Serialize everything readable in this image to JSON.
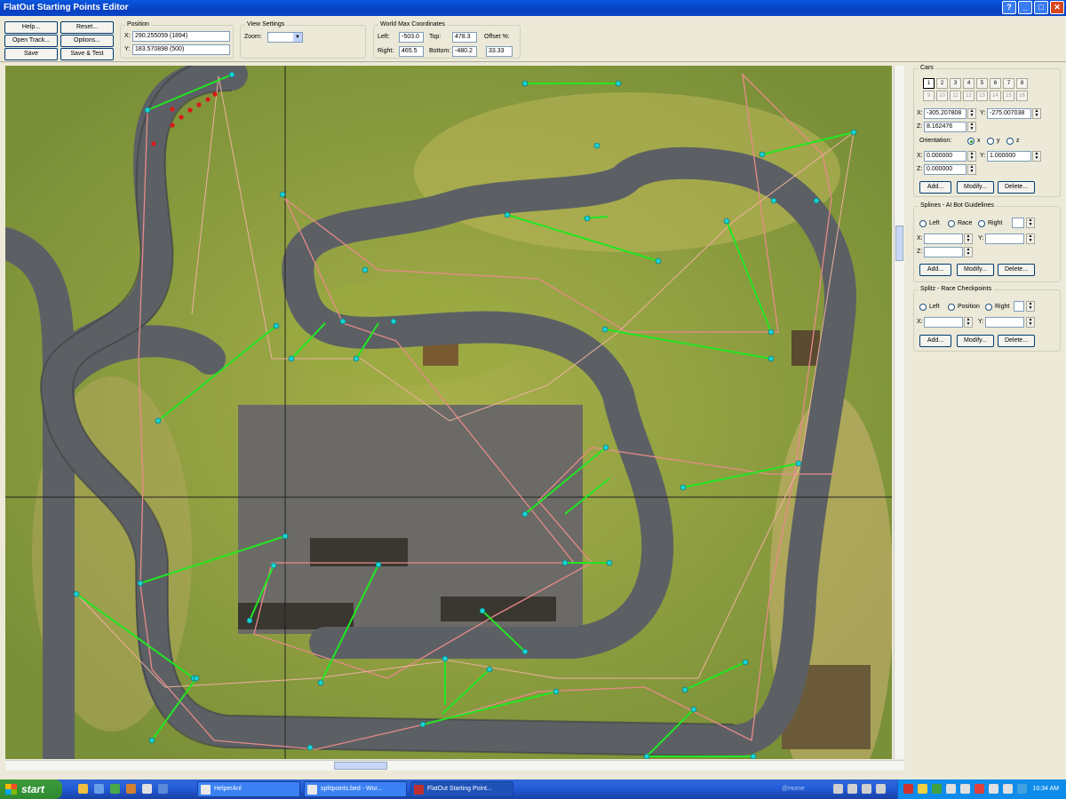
{
  "window": {
    "title": "FlatOut Starting Points Editor",
    "buttons": [
      "_",
      "□",
      "▭",
      "✕"
    ]
  },
  "toolbar": {
    "help": "Help...",
    "reset": "Reset...",
    "open_track": "Open Track...",
    "options": "Options...",
    "save": "Save",
    "save_test": "Save & Test"
  },
  "position": {
    "label": "Position",
    "x_label": "X:",
    "x_value": "290.255059  (1894)",
    "y_label": "Y:",
    "y_value": "183.570898  (500)"
  },
  "view": {
    "label": "View Settings",
    "zoom_label": "Zoom:",
    "zoom_value": ""
  },
  "world": {
    "label": "World Max Coordinates",
    "left_label": "Left:",
    "left": "-503.0",
    "top_label": "Top:",
    "top": "478.3",
    "right_label": "Right:",
    "right": "465.5",
    "bottom_label": "Bottom:",
    "bottom": "-480.2",
    "offset_label": "Offset %:",
    "offset": "33.33"
  },
  "cars": {
    "label": "Cars",
    "row1": [
      "1",
      "2",
      "3",
      "4",
      "5",
      "6",
      "7",
      "8"
    ],
    "row2": [
      "9",
      "10",
      "11",
      "12",
      "13",
      "14",
      "15",
      "16"
    ],
    "x_label": "X:",
    "x": "-305.207808",
    "y_label": "Y:",
    "y": "-275.007038",
    "z_label": "Z:",
    "z": "8.162476",
    "orientation_label": "Orientation:",
    "orient_x": "x",
    "orient_y": "y",
    "orient_z": "z",
    "ox_label": "X:",
    "ox": "0.000000",
    "oy_label": "Y:",
    "oy": "1.000000",
    "oz_label": "Z:",
    "oz": "0.000000",
    "add": "Add...",
    "modify": "Modify...",
    "delete": "Delete..."
  },
  "splines": {
    "label": "Splines - AI Bot Guidelines",
    "left": "Left",
    "race": "Race",
    "right": "Right",
    "x_label": "X:",
    "y_label": "Y:",
    "z_label": "Z:",
    "add": "Add...",
    "modify": "Modify...",
    "delete": "Delete..."
  },
  "checkpoints": {
    "label": "Splitz - Race Checkpoints",
    "left": "Left",
    "position": "Position",
    "right": "Right",
    "x_label": "X:",
    "y_label": "Y:",
    "add": "Add...",
    "modify": "Modify...",
    "delete": "Delete..."
  },
  "taskbar": {
    "start": "start",
    "tasks": [
      "HelperAnl",
      "splitpoints.bed - Wor...",
      "FlatOut Starting Point..."
    ],
    "tray_text": "@Home",
    "clock": "10:34 AM"
  },
  "colors": {
    "green_line": "#22e622",
    "pink_line": "#e88a8a",
    "cyan_node": "#19d2d2",
    "track": "#5a5e62"
  }
}
